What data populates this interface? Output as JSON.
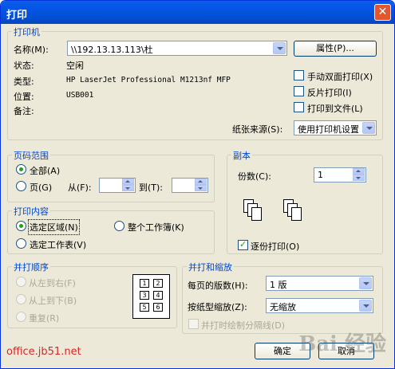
{
  "window": {
    "title": "打印",
    "close_glyph": "✕"
  },
  "printer": {
    "group_label": "打印机",
    "name_label": "名称(M):",
    "name_value": "\\\\192.13.13.113\\杜",
    "properties_button": "属性(P)...",
    "status_label": "状态:",
    "status_value": "空闲",
    "type_label": "类型:",
    "type_value": "HP LaserJet Professional M1213nf MFP",
    "where_label": "位置:",
    "where_value": "USB001",
    "comment_label": "备注:",
    "manual_duplex": "手动双面打印(X)",
    "reverse_print": "反片打印(I)",
    "print_to_file": "打印到文件(L)",
    "paper_source_label": "纸张来源(S):",
    "paper_source_value": "使用打印机设置"
  },
  "page_range": {
    "group_label": "页码范围",
    "all": "全部(A)",
    "pages": "页(G)",
    "from_label": "从(F):",
    "to_label": "到(T):",
    "from_value": "",
    "to_value": "",
    "selected": "all"
  },
  "print_what": {
    "group_label": "打印内容",
    "selection": "选定区域(N)",
    "entire_workbook": "整个工作簿(K)",
    "active_sheets": "选定工作表(V)",
    "selected": "selection"
  },
  "copies": {
    "group_label": "副本",
    "count_label": "份数(C):",
    "count_value": "1",
    "collate_label": "逐份打印(O)",
    "collate_checked": true
  },
  "page_order": {
    "group_label": "并打顺序",
    "left_to_right": "从左到右(F)",
    "top_to_bottom": "从上到下(B)",
    "repeat": "重复(R)",
    "grid_numbers": [
      "1",
      "2",
      "3",
      "4",
      "5",
      "6"
    ]
  },
  "zoom": {
    "group_label": "并打和缩放",
    "pages_per_sheet_label": "每页的版数(H):",
    "pages_per_sheet_value": "1 版",
    "scale_label": "按纸型缩放(Z):",
    "scale_value": "无缩放",
    "draw_borders": "并打时绘制分隔线(D)"
  },
  "footer": {
    "watermark": "office.jb51.net",
    "ok": "确定",
    "cancel": "取消",
    "baidu_mark": "Bai 经验"
  },
  "colors": {
    "group_label": "#0046d5",
    "title_bar": "#0456e8",
    "dialog_bg": "#ece9d8",
    "watermark": "#d62828"
  }
}
